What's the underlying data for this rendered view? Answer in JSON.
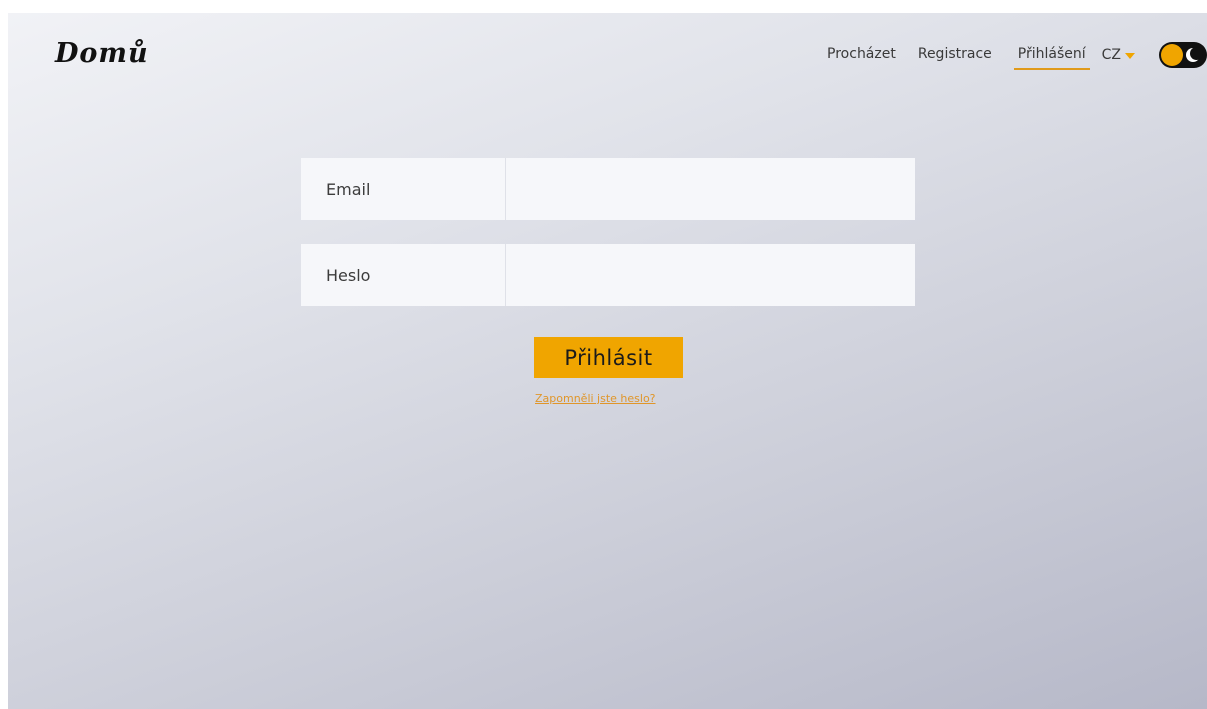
{
  "header": {
    "logo": "Domů",
    "nav": {
      "browse": "Procházet",
      "register": "Registrace",
      "login": "Přihlášení"
    },
    "language": "CZ",
    "theme_toggle_icon": "moon-icon"
  },
  "form": {
    "email_label": "Email",
    "email_value": "",
    "password_label": "Heslo",
    "password_value": "",
    "submit_label": "Přihlásit",
    "forgot_link": "Zapomněli jste heslo?"
  },
  "colors": {
    "accent": "#f0a500",
    "link": "#e0962a",
    "field_bg": "#f6f7fa",
    "toggle_bg": "#111111"
  }
}
